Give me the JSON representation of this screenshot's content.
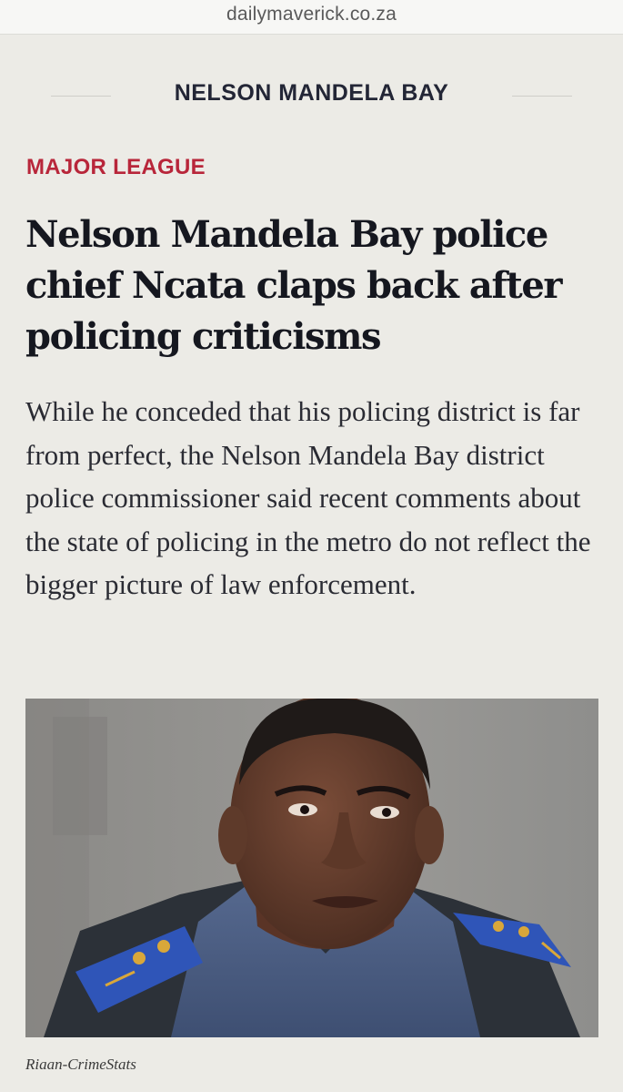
{
  "browser": {
    "url": "dailymaverick.co.za"
  },
  "section": {
    "title": "NELSON MANDELA BAY"
  },
  "article": {
    "kicker": "MAJOR LEAGUE",
    "headline": "Nelson Mandela Bay police chief Ncata claps back after policing criticisms",
    "summary": "While he conceded that his policing district is far from perfect, the Nelson Mandela Bay district police commissioner said recent comments about the state of policing in the metro do not reflect the bigger picture of law enforcement.",
    "image_credit": "Riaan-CrimeStats"
  },
  "colors": {
    "background": "#ecebe6",
    "kicker": "#b8263a",
    "uniform": "#4a5d84",
    "epaulette": "#2f55b8"
  }
}
